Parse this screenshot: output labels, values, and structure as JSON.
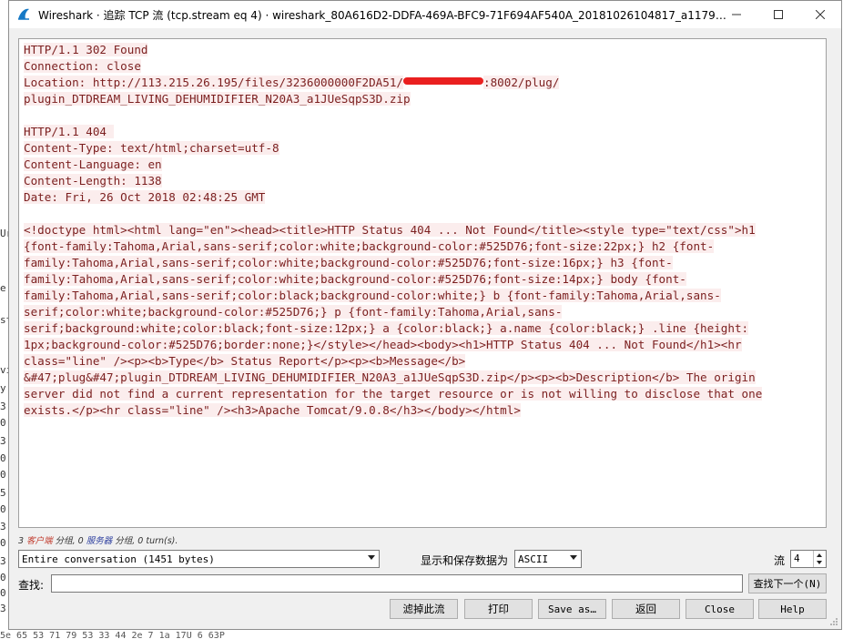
{
  "background": {
    "left_fragments": [
      "Ur",
      "e:",
      "st",
      "vi",
      "y",
      "3",
      "0",
      "3",
      "0",
      "0",
      "5",
      "0",
      "3",
      "0",
      "3",
      "0",
      "0",
      "3",
      "0",
      "0",
      "5",
      "0",
      "5",
      "0"
    ],
    "bottom_fragment": "5e 65  53 71 79 53 33 44 2e 7       1a  17U  6  63P"
  },
  "window": {
    "title": "Wireshark · 追踪 TCP 流 (tcp.stream eq 4) · wireshark_80A616D2-DDFA-469A-BFC9-71F694AF540A_20181026104817_a11792.pc…",
    "app_icon": "wireshark-fin-icon",
    "controls": {
      "minimize": "minimize-icon",
      "maximize": "maximize-icon",
      "close": "close-icon"
    }
  },
  "stream": {
    "lines": [
      {
        "text": "HTTP/1.1 302 Found",
        "hl": true
      },
      {
        "text": "Connection: close",
        "hl": true
      },
      {
        "text": "Location: http://113.215.26.195/files/3236000000F2DA51/",
        "after": ":8002/plug/",
        "redacted": true,
        "hl": true
      },
      {
        "text": "plugin_DTDREAM_LIVING_DEHUMIDIFIER_N20A3_a1JUeSqpS3D.zip",
        "hl": true
      },
      {
        "text": "",
        "hl": false
      },
      {
        "text": "HTTP/1.1 404 ",
        "hl": true
      },
      {
        "text": "Content-Type: text/html;charset=utf-8",
        "hl": true
      },
      {
        "text": "Content-Language: en",
        "hl": true
      },
      {
        "text": "Content-Length: 1138",
        "hl": true
      },
      {
        "text": "Date: Fri, 26 Oct 2018 02:48:25 GMT",
        "hl": true
      },
      {
        "text": "",
        "hl": false
      },
      {
        "text": "<!doctype html><html lang=\"en\"><head><title>HTTP Status 404 ... Not Found</title><style type=\"text/css\">h1",
        "hl": true
      },
      {
        "text": "{font-family:Tahoma,Arial,sans-serif;color:white;background-color:#525D76;font-size:22px;} h2 {font-",
        "hl": true
      },
      {
        "text": "family:Tahoma,Arial,sans-serif;color:white;background-color:#525D76;font-size:16px;} h3 {font-",
        "hl": true
      },
      {
        "text": "family:Tahoma,Arial,sans-serif;color:white;background-color:#525D76;font-size:14px;} body {font-",
        "hl": true
      },
      {
        "text": "family:Tahoma,Arial,sans-serif;color:black;background-color:white;} b {font-family:Tahoma,Arial,sans-",
        "hl": true
      },
      {
        "text": "serif;color:white;background-color:#525D76;} p {font-family:Tahoma,Arial,sans-",
        "hl": true
      },
      {
        "text": "serif;background:white;color:black;font-size:12px;} a {color:black;} a.name {color:black;} .line {height:",
        "hl": true
      },
      {
        "text": "1px;background-color:#525D76;border:none;}</style></head><body><h1>HTTP Status 404 ... Not Found</h1><hr",
        "hl": true
      },
      {
        "text": "class=\"line\" /><p><b>Type</b> Status Report</p><p><b>Message</b>",
        "hl": true
      },
      {
        "text": "&#47;plug&#47;plugin_DTDREAM_LIVING_DEHUMIDIFIER_N20A3_a1JUeSqpS3D.zip</p><p><b>Description</b> The origin",
        "hl": true
      },
      {
        "text": "server did not find a current representation for the target resource or is not willing to disclose that one",
        "hl": true
      },
      {
        "text": "exists.</p><hr class=\"line\" /><h3>Apache Tomcat/9.0.8</h3></body></html>",
        "hl": true
      }
    ],
    "text_color": "#7b1f1f",
    "highlight_color": "#fbeded"
  },
  "status": {
    "prefix": "3 ",
    "client": "客户端",
    "mid1": " 分组, 0 ",
    "server": "服务器",
    "mid2": " 分组, 0 turn(s)."
  },
  "controls": {
    "conversation_select": "Entire conversation (1451 bytes)",
    "show_save_label": "显示和保存数据为",
    "format_select": "ASCII",
    "stream_label": "流",
    "stream_value": "4",
    "find_label": "查找:",
    "find_value": "",
    "find_next_button": "查找下一个(N)"
  },
  "buttons": {
    "filter_out": "滤掉此流",
    "print": "打印",
    "save_as": "Save as…",
    "back": "返回",
    "close": "Close",
    "help": "Help"
  }
}
